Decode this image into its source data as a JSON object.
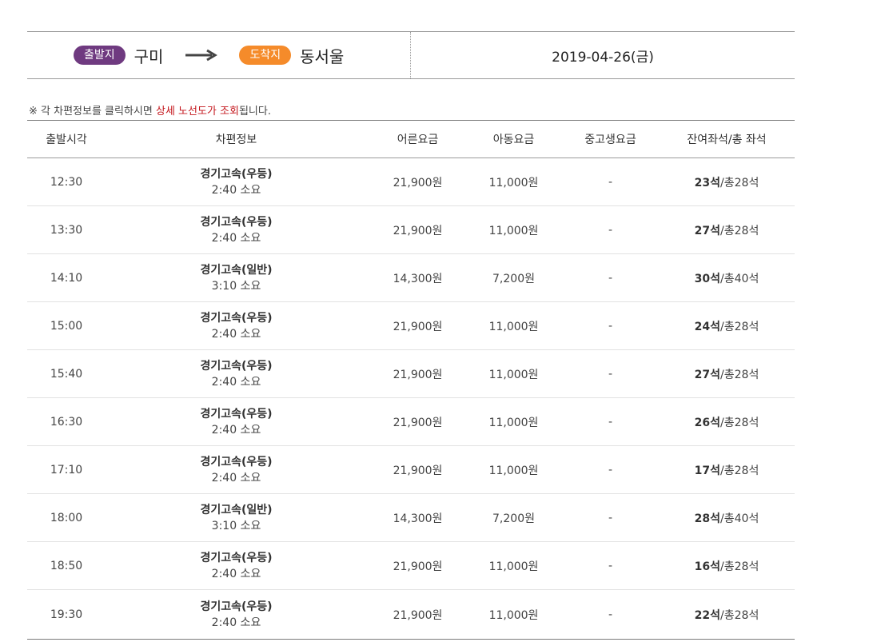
{
  "route": {
    "origin_badge": "출발지",
    "origin": "구미",
    "dest_badge": "도착지",
    "dest": "동서울",
    "date": "2019-04-26(금)"
  },
  "notice": {
    "prefix": "※ 각 차편정보를 클릭하시면 ",
    "highlight": "상세 노선도가 조회",
    "suffix": "됩니다."
  },
  "table": {
    "headers": [
      "출발시각",
      "차편정보",
      "어른요금",
      "아동요금",
      "중고생요금",
      "잔여좌석/총 좌석"
    ],
    "rows": [
      {
        "time": "12:30",
        "name": "경기고속(우등)",
        "duration": "2:40 소요",
        "adult": "21,900원",
        "child": "11,000원",
        "student": "-",
        "seats_left": "23석",
        "seats_total": "/총28석"
      },
      {
        "time": "13:30",
        "name": "경기고속(우등)",
        "duration": "2:40 소요",
        "adult": "21,900원",
        "child": "11,000원",
        "student": "-",
        "seats_left": "27석",
        "seats_total": "/총28석"
      },
      {
        "time": "14:10",
        "name": "경기고속(일반)",
        "duration": "3:10 소요",
        "adult": "14,300원",
        "child": "7,200원",
        "student": "-",
        "seats_left": "30석",
        "seats_total": "/총40석"
      },
      {
        "time": "15:00",
        "name": "경기고속(우등)",
        "duration": "2:40 소요",
        "adult": "21,900원",
        "child": "11,000원",
        "student": "-",
        "seats_left": "24석",
        "seats_total": "/총28석"
      },
      {
        "time": "15:40",
        "name": "경기고속(우등)",
        "duration": "2:40 소요",
        "adult": "21,900원",
        "child": "11,000원",
        "student": "-",
        "seats_left": "27석",
        "seats_total": "/총28석"
      },
      {
        "time": "16:30",
        "name": "경기고속(우등)",
        "duration": "2:40 소요",
        "adult": "21,900원",
        "child": "11,000원",
        "student": "-",
        "seats_left": "26석",
        "seats_total": "/총28석"
      },
      {
        "time": "17:10",
        "name": "경기고속(우등)",
        "duration": "2:40 소요",
        "adult": "21,900원",
        "child": "11,000원",
        "student": "-",
        "seats_left": "17석",
        "seats_total": "/총28석"
      },
      {
        "time": "18:00",
        "name": "경기고속(일반)",
        "duration": "3:10 소요",
        "adult": "14,300원",
        "child": "7,200원",
        "student": "-",
        "seats_left": "28석",
        "seats_total": "/총40석"
      },
      {
        "time": "18:50",
        "name": "경기고속(우등)",
        "duration": "2:40 소요",
        "adult": "21,900원",
        "child": "11,000원",
        "student": "-",
        "seats_left": "16석",
        "seats_total": "/총28석"
      },
      {
        "time": "19:30",
        "name": "경기고속(우등)",
        "duration": "2:40 소요",
        "adult": "21,900원",
        "child": "11,000원",
        "student": "-",
        "seats_left": "22석",
        "seats_total": "/총28석"
      }
    ]
  },
  "colors": {
    "origin_badge": "#6f3a80",
    "dest_badge": "#f58b2a",
    "highlight": "#c4161c"
  },
  "icons": {
    "route_arrow": "arrow-right-icon"
  }
}
